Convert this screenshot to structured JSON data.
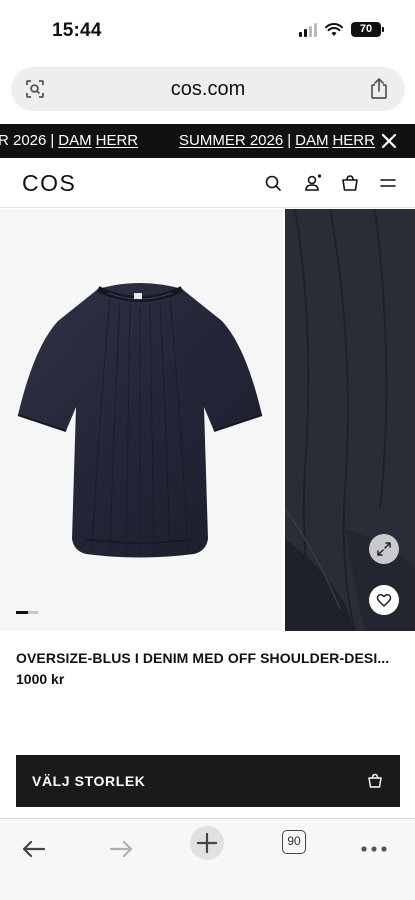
{
  "status": {
    "time": "15:44",
    "battery": "70"
  },
  "browser": {
    "url": "cos.com",
    "tab_count": "90"
  },
  "promo": {
    "segment_a": {
      "text": "R 2026",
      "sep": "|",
      "link1": "DAM",
      "link2": "HERR"
    },
    "segment_b": {
      "text": "SUMMER 2026",
      "sep": "|",
      "link1": "DAM",
      "link2": "HERR"
    }
  },
  "header": {
    "logo": "COS"
  },
  "product": {
    "title": "OVERSIZE-BLUS I DENIM MED OFF SHOULDER-DESI...",
    "price": "1000 kr",
    "image_count": 2,
    "active_image": 1
  },
  "cta": {
    "label": "VÄLJ STORLEK"
  },
  "icons": {
    "url_left": "visual-search-icon",
    "url_right": "share-icon",
    "promo_close": "close-icon",
    "search": "search-icon",
    "account": "account-icon",
    "bag": "bag-icon",
    "menu": "menu-icon",
    "expand": "expand-icon",
    "favorite": "heart-icon",
    "cta": "bag-icon",
    "back": "back-arrow-icon",
    "forward": "forward-arrow-icon",
    "new_tab": "plus-icon",
    "more": "more-icon"
  },
  "colors": {
    "banner_bg": "#111111",
    "cta_bg": "#1a1a1a",
    "denim": "#262a38"
  }
}
